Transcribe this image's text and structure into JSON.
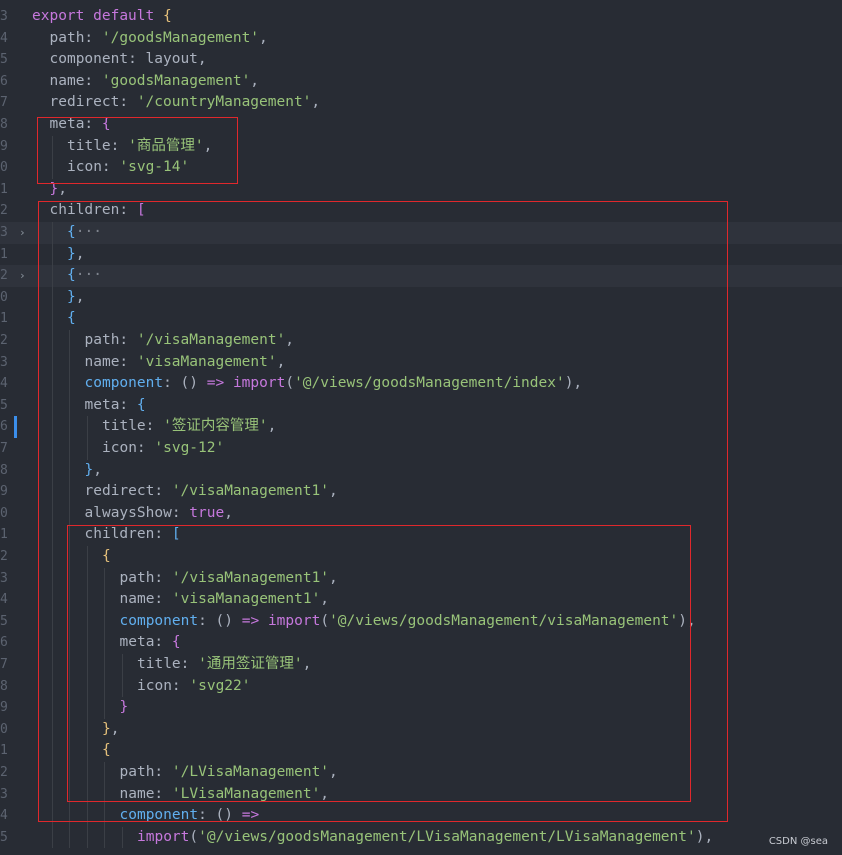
{
  "lines": [
    {
      "num": "3",
      "indent": 0,
      "tokens": [
        [
          "kw",
          "export"
        ],
        [
          "pl",
          " "
        ],
        [
          "kw",
          "default"
        ],
        [
          "pl",
          " "
        ],
        [
          "b1",
          "{"
        ]
      ]
    },
    {
      "num": "4",
      "indent": 1,
      "tokens": [
        [
          "prop",
          "path"
        ],
        [
          "pl",
          ": "
        ],
        [
          "str",
          "'/goodsManagement'"
        ],
        [
          "pl",
          ","
        ]
      ]
    },
    {
      "num": "5",
      "indent": 1,
      "tokens": [
        [
          "prop",
          "component"
        ],
        [
          "pl",
          ": layout,"
        ]
      ]
    },
    {
      "num": "6",
      "indent": 1,
      "tokens": [
        [
          "prop",
          "name"
        ],
        [
          "pl",
          ": "
        ],
        [
          "str",
          "'goodsManagement'"
        ],
        [
          "pl",
          ","
        ]
      ]
    },
    {
      "num": "7",
      "indent": 1,
      "tokens": [
        [
          "prop",
          "redirect"
        ],
        [
          "pl",
          ": "
        ],
        [
          "str",
          "'/countryManagement'"
        ],
        [
          "pl",
          ","
        ]
      ]
    },
    {
      "num": "8",
      "indent": 1,
      "tokens": [
        [
          "prop",
          "meta"
        ],
        [
          "pl",
          ": "
        ],
        [
          "b2",
          "{"
        ]
      ]
    },
    {
      "num": "9",
      "indent": 2,
      "tokens": [
        [
          "prop",
          "title"
        ],
        [
          "pl",
          ": "
        ],
        [
          "str",
          "'商品管理'"
        ],
        [
          "pl",
          ","
        ]
      ]
    },
    {
      "num": "0",
      "indent": 2,
      "tokens": [
        [
          "prop",
          "icon"
        ],
        [
          "pl",
          ": "
        ],
        [
          "str",
          "'svg-14'"
        ]
      ]
    },
    {
      "num": "1",
      "indent": 1,
      "tokens": [
        [
          "b2",
          "}"
        ],
        [
          "pl",
          ","
        ]
      ]
    },
    {
      "num": "2",
      "indent": 1,
      "tokens": [
        [
          "prop",
          "children"
        ],
        [
          "pl",
          ": "
        ],
        [
          "b2",
          "["
        ]
      ]
    },
    {
      "num": "3",
      "indent": 2,
      "fold": "›",
      "folded": true,
      "tokens": [
        [
          "b3",
          "{"
        ],
        [
          "ell",
          "···"
        ]
      ]
    },
    {
      "num": "1",
      "indent": 2,
      "tokens": [
        [
          "b3",
          "}"
        ],
        [
          "pl",
          ","
        ]
      ]
    },
    {
      "num": "2",
      "indent": 2,
      "fold": "›",
      "folded": true,
      "tokens": [
        [
          "b3",
          "{"
        ],
        [
          "ell",
          "···"
        ]
      ]
    },
    {
      "num": "0",
      "indent": 2,
      "tokens": [
        [
          "b3",
          "}"
        ],
        [
          "pl",
          ","
        ]
      ]
    },
    {
      "num": "1",
      "indent": 2,
      "tokens": [
        [
          "b3",
          "{"
        ]
      ]
    },
    {
      "num": "2",
      "indent": 3,
      "tokens": [
        [
          "prop",
          "path"
        ],
        [
          "pl",
          ": "
        ],
        [
          "str",
          "'/visaManagement'"
        ],
        [
          "pl",
          ","
        ]
      ]
    },
    {
      "num": "3",
      "indent": 3,
      "tokens": [
        [
          "prop",
          "name"
        ],
        [
          "pl",
          ": "
        ],
        [
          "str",
          "'visaManagement'"
        ],
        [
          "pl",
          ","
        ]
      ]
    },
    {
      "num": "4",
      "indent": 3,
      "tokens": [
        [
          "fn",
          "component"
        ],
        [
          "pl",
          ": () "
        ],
        [
          "kw",
          "=>"
        ],
        [
          "pl",
          " "
        ],
        [
          "kw",
          "import"
        ],
        [
          "pl",
          "("
        ],
        [
          "str",
          "'@/views/goodsManagement/index'"
        ],
        [
          "pl",
          "),"
        ]
      ]
    },
    {
      "num": "5",
      "indent": 3,
      "tokens": [
        [
          "prop",
          "meta"
        ],
        [
          "pl",
          ": "
        ],
        [
          "b3",
          "{"
        ]
      ]
    },
    {
      "num": "6",
      "indent": 4,
      "mod": true,
      "tokens": [
        [
          "prop",
          "title"
        ],
        [
          "pl",
          ": "
        ],
        [
          "str",
          "'签证内容管理'"
        ],
        [
          "pl",
          ","
        ]
      ]
    },
    {
      "num": "7",
      "indent": 4,
      "tokens": [
        [
          "prop",
          "icon"
        ],
        [
          "pl",
          ": "
        ],
        [
          "str",
          "'svg-12'"
        ]
      ]
    },
    {
      "num": "8",
      "indent": 3,
      "tokens": [
        [
          "b3",
          "}"
        ],
        [
          "pl",
          ","
        ]
      ]
    },
    {
      "num": "9",
      "indent": 3,
      "tokens": [
        [
          "prop",
          "redirect"
        ],
        [
          "pl",
          ": "
        ],
        [
          "str",
          "'/visaManagement1'"
        ],
        [
          "pl",
          ","
        ]
      ]
    },
    {
      "num": "0",
      "indent": 3,
      "tokens": [
        [
          "prop",
          "alwaysShow"
        ],
        [
          "pl",
          ": "
        ],
        [
          "bool",
          "true"
        ],
        [
          "pl",
          ","
        ]
      ]
    },
    {
      "num": "1",
      "indent": 3,
      "tokens": [
        [
          "prop",
          "children"
        ],
        [
          "pl",
          ": "
        ],
        [
          "b3",
          "["
        ]
      ]
    },
    {
      "num": "2",
      "indent": 4,
      "tokens": [
        [
          "b1",
          "{"
        ]
      ]
    },
    {
      "num": "3",
      "indent": 5,
      "tokens": [
        [
          "prop",
          "path"
        ],
        [
          "pl",
          ": "
        ],
        [
          "str",
          "'/visaManagement1'"
        ],
        [
          "pl",
          ","
        ]
      ]
    },
    {
      "num": "4",
      "indent": 5,
      "tokens": [
        [
          "prop",
          "name"
        ],
        [
          "pl",
          ": "
        ],
        [
          "str",
          "'visaManagement1'"
        ],
        [
          "pl",
          ","
        ]
      ]
    },
    {
      "num": "5",
      "indent": 5,
      "tokens": [
        [
          "fn",
          "component"
        ],
        [
          "pl",
          ": () "
        ],
        [
          "kw",
          "=>"
        ],
        [
          "pl",
          " "
        ],
        [
          "kw",
          "import"
        ],
        [
          "pl",
          "("
        ],
        [
          "str",
          "'@/views/goodsManagement/visaManagement'"
        ],
        [
          "pl",
          "),"
        ]
      ]
    },
    {
      "num": "6",
      "indent": 5,
      "tokens": [
        [
          "prop",
          "meta"
        ],
        [
          "pl",
          ": "
        ],
        [
          "b2",
          "{"
        ]
      ]
    },
    {
      "num": "7",
      "indent": 6,
      "tokens": [
        [
          "prop",
          "title"
        ],
        [
          "pl",
          ": "
        ],
        [
          "str",
          "'通用签证管理'"
        ],
        [
          "pl",
          ","
        ]
      ]
    },
    {
      "num": "8",
      "indent": 6,
      "tokens": [
        [
          "prop",
          "icon"
        ],
        [
          "pl",
          ": "
        ],
        [
          "str",
          "'svg22'"
        ]
      ]
    },
    {
      "num": "9",
      "indent": 5,
      "tokens": [
        [
          "b2",
          "}"
        ]
      ]
    },
    {
      "num": "0",
      "indent": 4,
      "tokens": [
        [
          "b1",
          "}"
        ],
        [
          "pl",
          ","
        ]
      ]
    },
    {
      "num": "1",
      "indent": 4,
      "tokens": [
        [
          "b1",
          "{"
        ]
      ]
    },
    {
      "num": "2",
      "indent": 5,
      "tokens": [
        [
          "prop",
          "path"
        ],
        [
          "pl",
          ": "
        ],
        [
          "str",
          "'/LVisaManagement'"
        ],
        [
          "pl",
          ","
        ]
      ]
    },
    {
      "num": "3",
      "indent": 5,
      "tokens": [
        [
          "prop",
          "name"
        ],
        [
          "pl",
          ": "
        ],
        [
          "str",
          "'LVisaManagement'"
        ],
        [
          "pl",
          ","
        ]
      ]
    },
    {
      "num": "4",
      "indent": 5,
      "tokens": [
        [
          "fn",
          "component"
        ],
        [
          "pl",
          ": () "
        ],
        [
          "kw",
          "=>"
        ]
      ]
    },
    {
      "num": "5",
      "indent": 6,
      "tokens": [
        [
          "kw",
          "import"
        ],
        [
          "pl",
          "("
        ],
        [
          "str",
          "'@/views/goodsManagement/LVisaManagement/LVisaManagement'"
        ],
        [
          "pl",
          "),"
        ]
      ]
    }
  ],
  "watermark": "CSDN @sea",
  "colors": {
    "background": "#282c34",
    "highlight_box": "#e0282c",
    "keyword": "#c678dd",
    "string": "#98c379",
    "function": "#61afef"
  }
}
